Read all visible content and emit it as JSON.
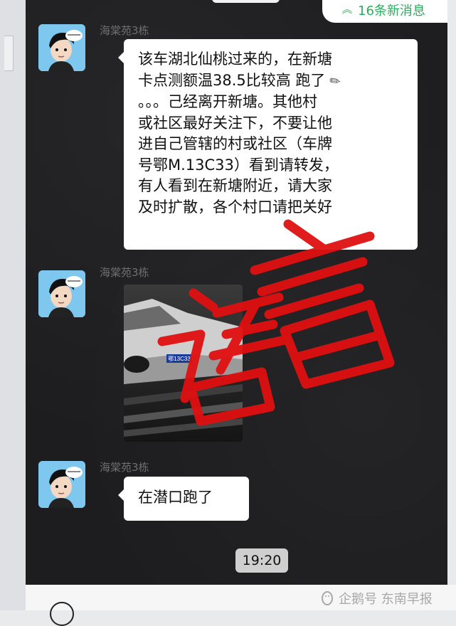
{
  "chat": {
    "new_messages_label": "16条新消息",
    "sender_name": "海棠苑3栋",
    "messages": [
      {
        "type": "text",
        "sender": "海棠苑3栋",
        "lines": [
          "该车湖北仙桃过来的，在新塘",
          "卡点测额温38.5比较高 跑了",
          "。。。己经离开新塘。其他村",
          "或社区最好关注下，不要让他",
          "进自己管辖的村或社区（车牌",
          "号鄂M.13C33）看到请转发，",
          "有人看到在新塘附近，请大家",
          "及时扩散，各个村口请把关好"
        ]
      },
      {
        "type": "image",
        "sender": "海棠苑3栋",
        "plate_text": "鄂13C33"
      },
      {
        "type": "text",
        "sender": "海棠苑3栋",
        "text": "在潜口跑了"
      }
    ],
    "timestamp": "19:20"
  },
  "stamp": {
    "text": "谣言",
    "color": "#e01010"
  },
  "watermark": {
    "text": "企鹅号 东南早报"
  },
  "colors": {
    "accent_green": "#2bae5c",
    "chat_bg": "#1d1d1f",
    "bubble": "#ffffff"
  }
}
